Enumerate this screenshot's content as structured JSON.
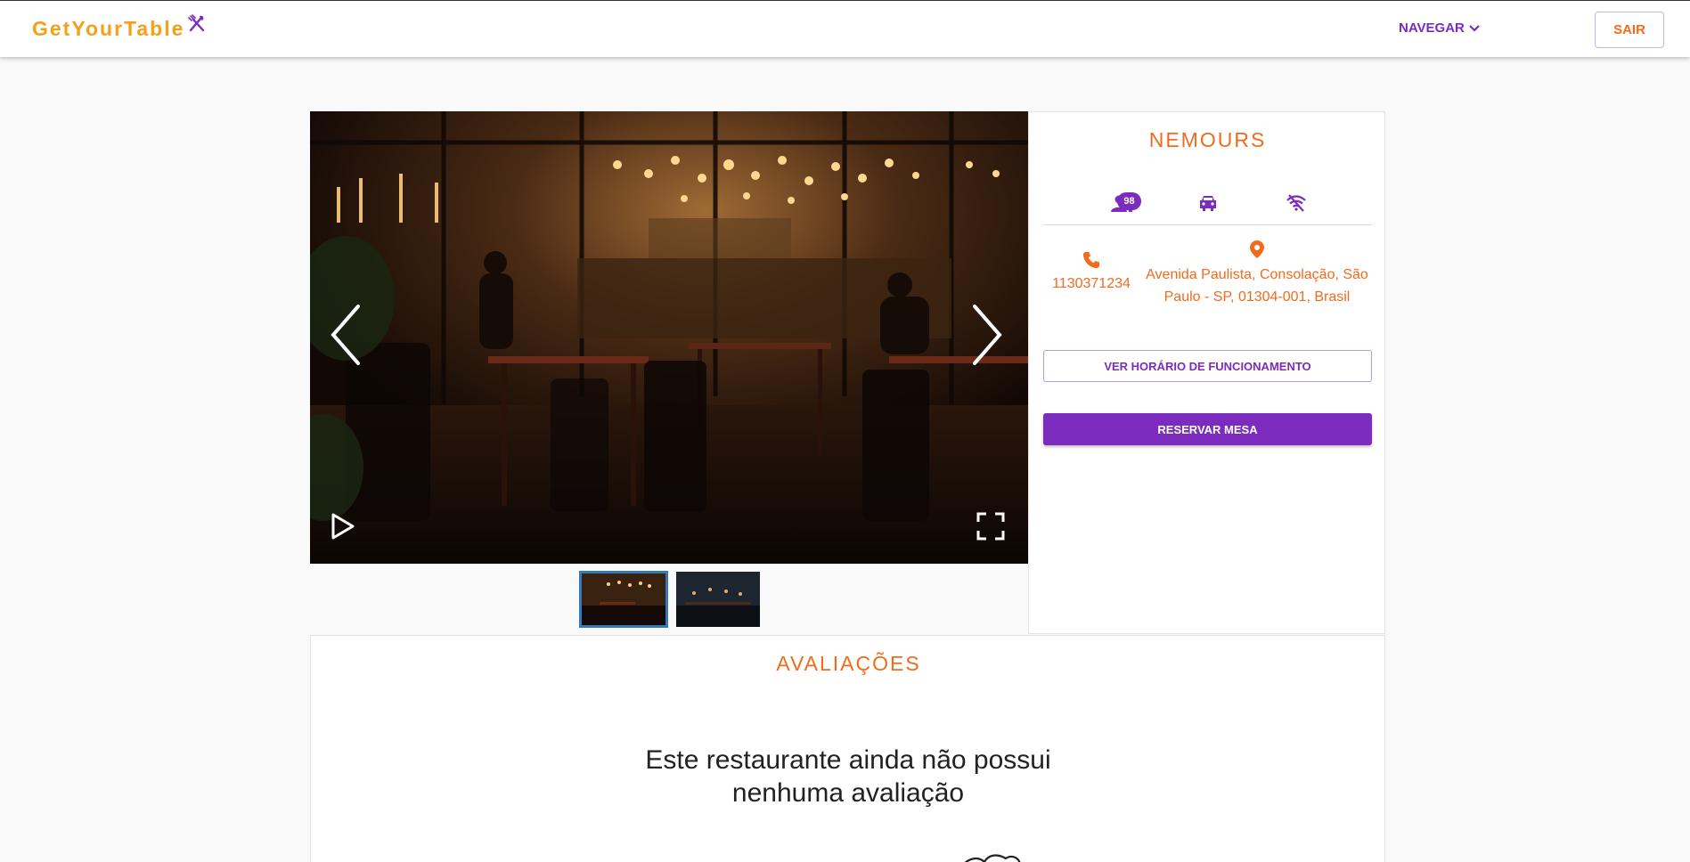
{
  "header": {
    "logo_text": "GetYourTable",
    "logo_icon": "fork-knife-icon",
    "nav_label": "NAVEGAR",
    "logout_label": "SAIR"
  },
  "gallery": {
    "prev_icon": "chevron-left-icon",
    "next_icon": "chevron-right-icon",
    "play_icon": "play-icon",
    "fullscreen_icon": "fullscreen-icon",
    "thumbnails": [
      {
        "name": "thumb-1",
        "active": true
      },
      {
        "name": "thumb-2",
        "active": false
      }
    ]
  },
  "restaurant": {
    "name": "NEMOURS",
    "capacity_badge": "98",
    "amenities": [
      "people-icon",
      "car-icon",
      "wifi-off-icon"
    ],
    "phone": "1130371234",
    "address": "Avenida Paulista, Consolação, São Paulo - SP, 01304-001, Brasil",
    "hours_button": "VER HORÁRIO DE FUNCIONAMENTO",
    "reserve_button": "RESERVAR MESA"
  },
  "reviews": {
    "title": "AVALIAÇÕES",
    "empty_message": "Este restaurante ainda não possui nenhuma avaliação"
  },
  "colors": {
    "brand_orange": "#f26b1d",
    "logo_yellow": "#f6a01a",
    "accent_purple": "#7b2cbf",
    "thumb_active_border": "#337ab7"
  }
}
